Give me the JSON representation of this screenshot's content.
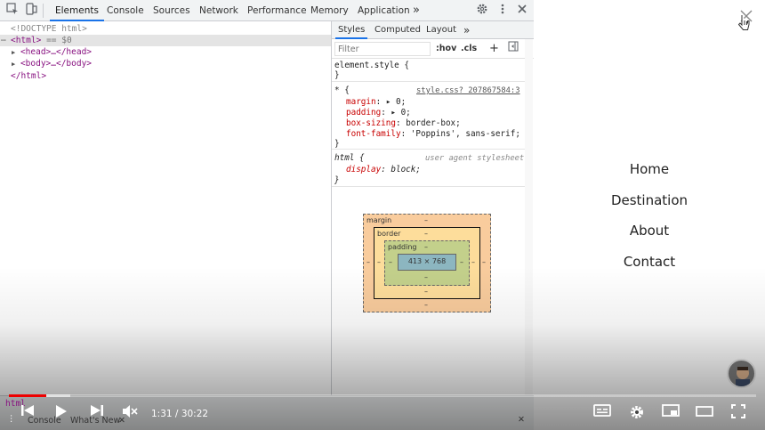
{
  "devtools": {
    "tabs": [
      "Elements",
      "Console",
      "Sources",
      "Network",
      "Performance",
      "Memory",
      "Application"
    ],
    "active_tab": "Elements",
    "more_tabs_glyph": "»",
    "elements": {
      "doctype": "<!DOCTYPE html>",
      "html_open": "<html>",
      "selected_marker": "== $0",
      "head": "<head>…</head>",
      "body": "<body>…</body>",
      "html_close": "</html>"
    },
    "styles": {
      "tabs": [
        "Styles",
        "Computed",
        "Layout"
      ],
      "more_glyph": "»",
      "filter_placeholder": "Filter",
      "hov": ":hov",
      "cls": ".cls",
      "add_glyph": "+",
      "element_style_selector": "element.style {",
      "element_style_close": "}",
      "universal_selector": "* {",
      "universal_source": "style.css?_207867584:3",
      "universal_props": [
        {
          "name": "margin",
          "sep": ": ▸ ",
          "value": "0;"
        },
        {
          "name": "padding",
          "sep": ": ▸ ",
          "value": "0;"
        },
        {
          "name": "box-sizing",
          "sep": ": ",
          "value": "border-box;"
        },
        {
          "name": "font-family",
          "sep": ": ",
          "value": "'Poppins', sans-serif;"
        }
      ],
      "universal_close": "}",
      "html_selector": "html {",
      "ua_note": "user agent stylesheet",
      "html_prop_name": "display",
      "html_prop_value": "block;",
      "html_close": "}"
    },
    "box_model": {
      "margin_label": "margin",
      "border_label": "border",
      "padding_label": "padding",
      "dash": "–",
      "content_size": "413 × 768",
      "colors": {
        "margin": "#f9cc9d",
        "border": "#fddd9b",
        "padding": "#c3d08b",
        "content": "#8cb6c0"
      }
    },
    "breadcrumb": "html",
    "drawer": {
      "tabs": [
        "Console",
        "What's New"
      ]
    }
  },
  "webpage": {
    "nav": [
      "Home",
      "Destination",
      "About",
      "Contact"
    ]
  },
  "player": {
    "time_current": "1:31",
    "time_total": "30:22",
    "time_sep": " / ",
    "played": 0.05,
    "loaded": 0.082,
    "colors": {
      "played": "#ee0000"
    }
  }
}
